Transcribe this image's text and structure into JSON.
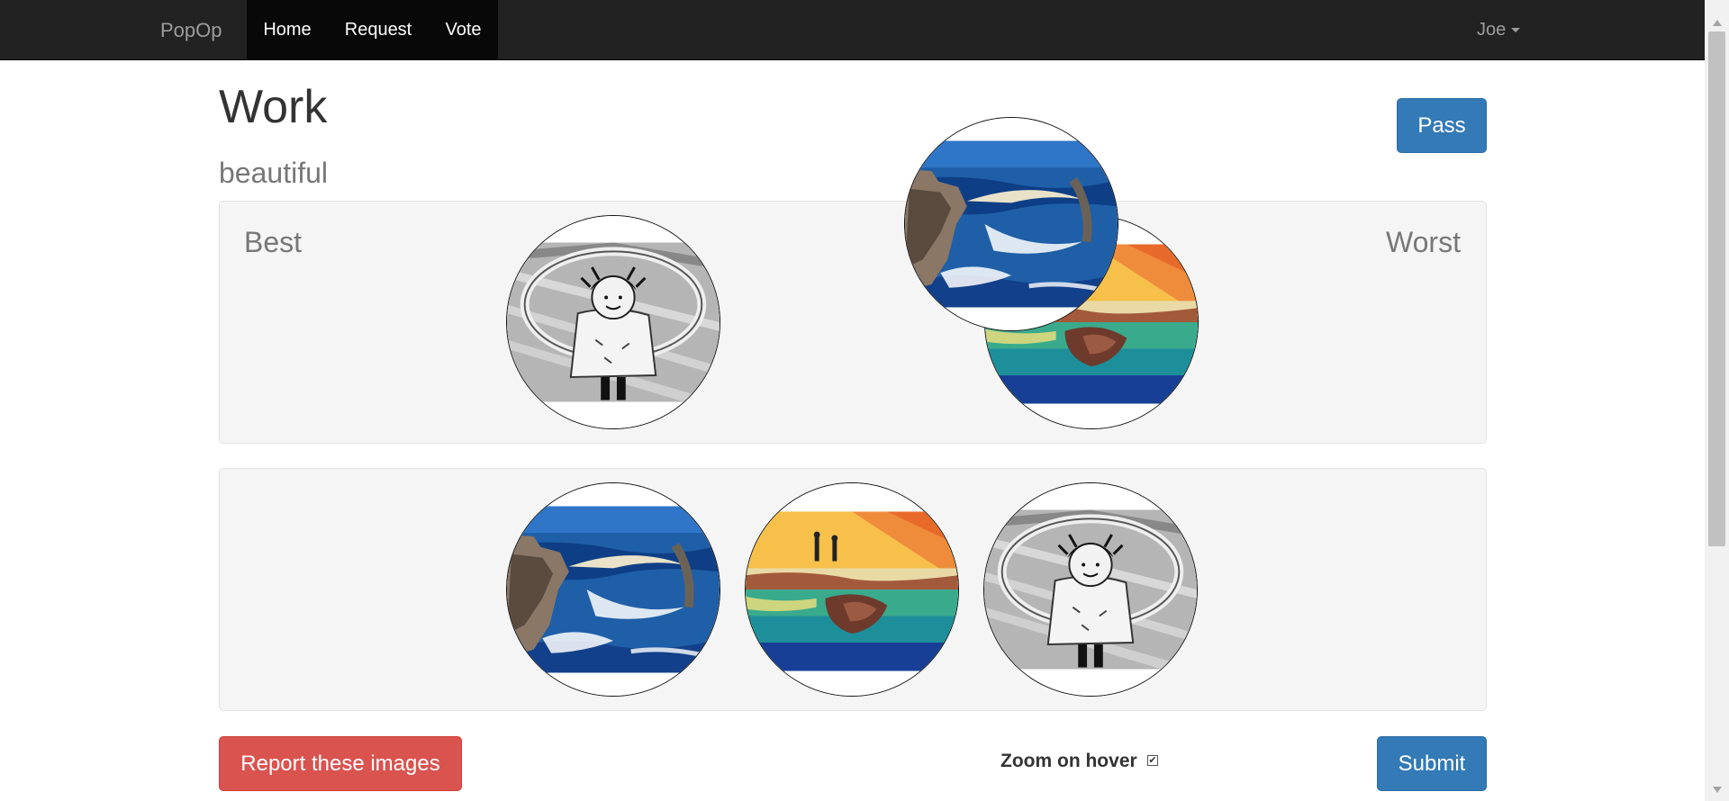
{
  "navbar": {
    "brand": "PopOp",
    "items": [
      {
        "label": "Home"
      },
      {
        "label": "Request"
      },
      {
        "label": "Vote"
      }
    ],
    "user": "Joe"
  },
  "page": {
    "title": "Work",
    "subtitle": "beautiful"
  },
  "actions": {
    "pass_label": "Pass",
    "submit_label": "Submit",
    "report_label": "Report these images"
  },
  "ranking": {
    "best_label": "Best",
    "worst_label": "Worst",
    "placed_images": [
      "girl-jump-rope-sketch",
      "sunset-rocks-painting",
      "coastal-waves-painting"
    ]
  },
  "pool": {
    "images": [
      "coastal-waves-painting",
      "sunset-rocks-painting",
      "girl-jump-rope-sketch"
    ]
  },
  "options": {
    "zoom_label": "Zoom on hover",
    "zoom_checked": true
  },
  "colors": {
    "navbar": "#222222",
    "primary": "#337ab7",
    "danger": "#d9534f",
    "well": "#f5f5f5"
  }
}
